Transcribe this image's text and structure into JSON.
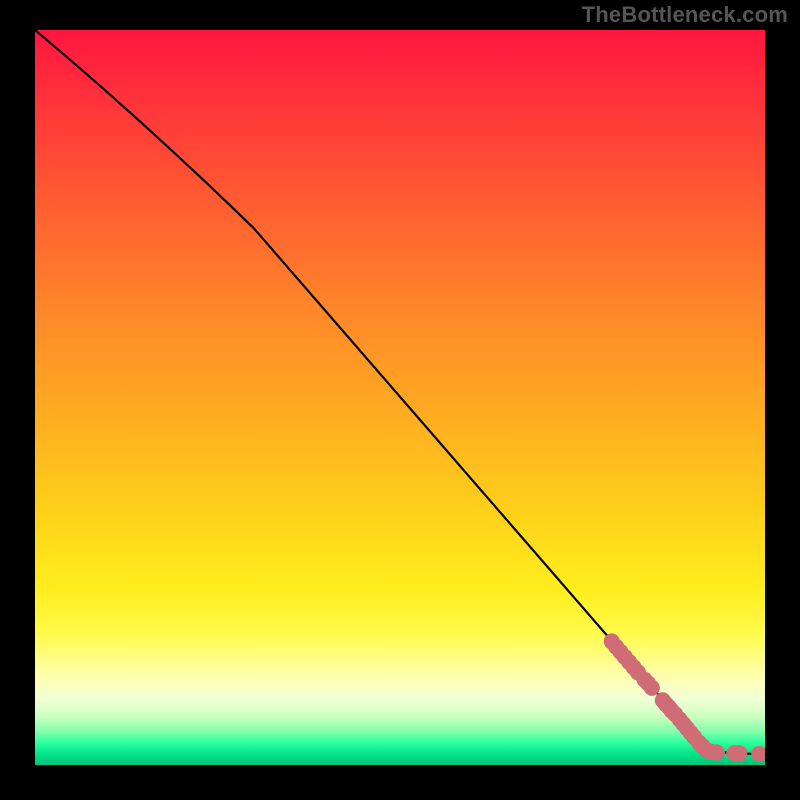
{
  "watermark": "TheBottleneck.com",
  "chart_data": {
    "type": "line",
    "title": "",
    "xlabel": "",
    "ylabel": "",
    "xlim": [
      0,
      100
    ],
    "ylim": [
      0,
      100
    ],
    "grid": false,
    "line": {
      "name": "curve",
      "color": "#000000",
      "points": [
        {
          "x": 0,
          "y": 100
        },
        {
          "x": 30,
          "y": 73
        },
        {
          "x": 92,
          "y": 2
        },
        {
          "x": 100,
          "y": 1.5
        }
      ]
    },
    "markers": {
      "name": "points",
      "color": "#cf6c76",
      "radius": 1.1,
      "xy": [
        [
          79.0,
          16.8
        ],
        [
          79.6,
          16.1
        ],
        [
          80.2,
          15.4
        ],
        [
          80.8,
          14.7
        ],
        [
          81.4,
          14.0
        ],
        [
          82.0,
          13.3
        ],
        [
          82.6,
          12.6
        ],
        [
          83.5,
          11.6
        ],
        [
          84.0,
          11.1
        ],
        [
          84.5,
          10.5
        ],
        [
          86.0,
          8.8
        ],
        [
          86.4,
          8.3
        ],
        [
          86.8,
          7.9
        ],
        [
          87.2,
          7.4
        ],
        [
          87.7,
          6.9
        ],
        [
          88.3,
          6.2
        ],
        [
          88.8,
          5.6
        ],
        [
          89.3,
          5.0
        ],
        [
          89.8,
          4.4
        ],
        [
          90.3,
          3.8
        ],
        [
          91.0,
          3.0
        ],
        [
          91.5,
          2.5
        ],
        [
          92.0,
          2.0
        ],
        [
          92.6,
          1.8
        ],
        [
          93.4,
          1.7
        ],
        [
          95.8,
          1.6
        ],
        [
          96.5,
          1.6
        ],
        [
          99.2,
          1.5
        ]
      ]
    }
  }
}
